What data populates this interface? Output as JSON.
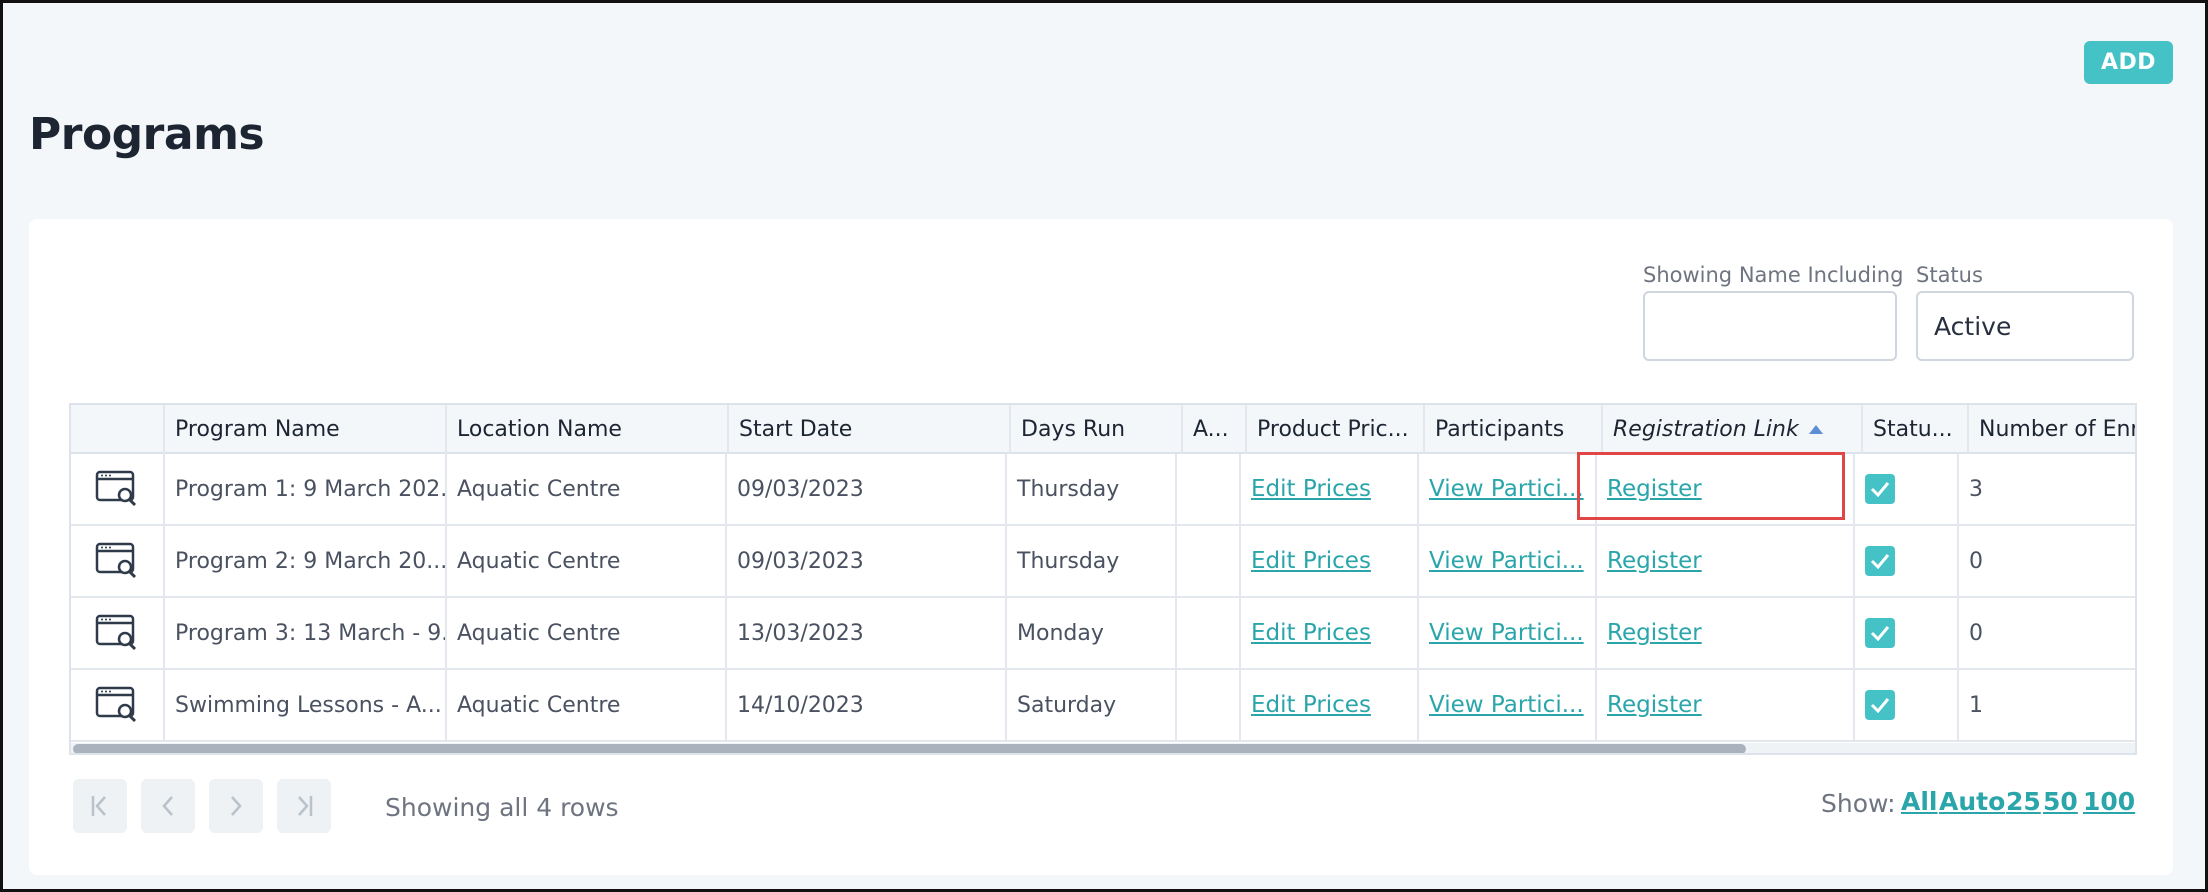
{
  "header": {
    "title": "Programs",
    "add_label": "ADD"
  },
  "filters": {
    "name_label": "Showing Name Including",
    "name_value": "",
    "status_label": "Status",
    "status_value": "Active"
  },
  "table": {
    "columns": [
      "Program Name",
      "Location Name",
      "Start Date",
      "Days Run",
      "A...",
      "Product Pric...",
      "Participants",
      "Registration Link",
      "Statu...",
      "Number of Enro"
    ],
    "rows": [
      {
        "name": "Program 1: 9 March 202...",
        "location": "Aquatic Centre",
        "start": "09/03/2023",
        "days": "Thursday",
        "a": "",
        "prices": "Edit Prices",
        "participants": "View Partici...",
        "registration": "Register",
        "status_checked": true,
        "enrolments": "3"
      },
      {
        "name": "Program 2: 9 March 20...",
        "location": "Aquatic Centre",
        "start": "09/03/2023",
        "days": "Thursday",
        "a": "",
        "prices": "Edit Prices",
        "participants": "View Partici...",
        "registration": "Register",
        "status_checked": true,
        "enrolments": "0"
      },
      {
        "name": "Program 3: 13 March - 9...",
        "location": "Aquatic Centre",
        "start": "13/03/2023",
        "days": "Monday",
        "a": "",
        "prices": "Edit Prices",
        "participants": "View Partici...",
        "registration": "Register",
        "status_checked": true,
        "enrolments": "0"
      },
      {
        "name": "Swimming Lessons - A...",
        "location": "Aquatic Centre",
        "start": "14/10/2023",
        "days": "Saturday",
        "a": "",
        "prices": "Edit Prices",
        "participants": "View Partici...",
        "registration": "Register",
        "status_checked": true,
        "enrolments": "1"
      }
    ],
    "sorted_column": "Registration Link"
  },
  "footer": {
    "rows_text": "Showing all 4 rows",
    "show_label": "Show:",
    "show_options": [
      "All",
      "Auto",
      "25",
      "50",
      "100"
    ]
  },
  "colors": {
    "accent": "#45c2c6",
    "link": "#2aa6ab",
    "highlight": "#e04646"
  }
}
